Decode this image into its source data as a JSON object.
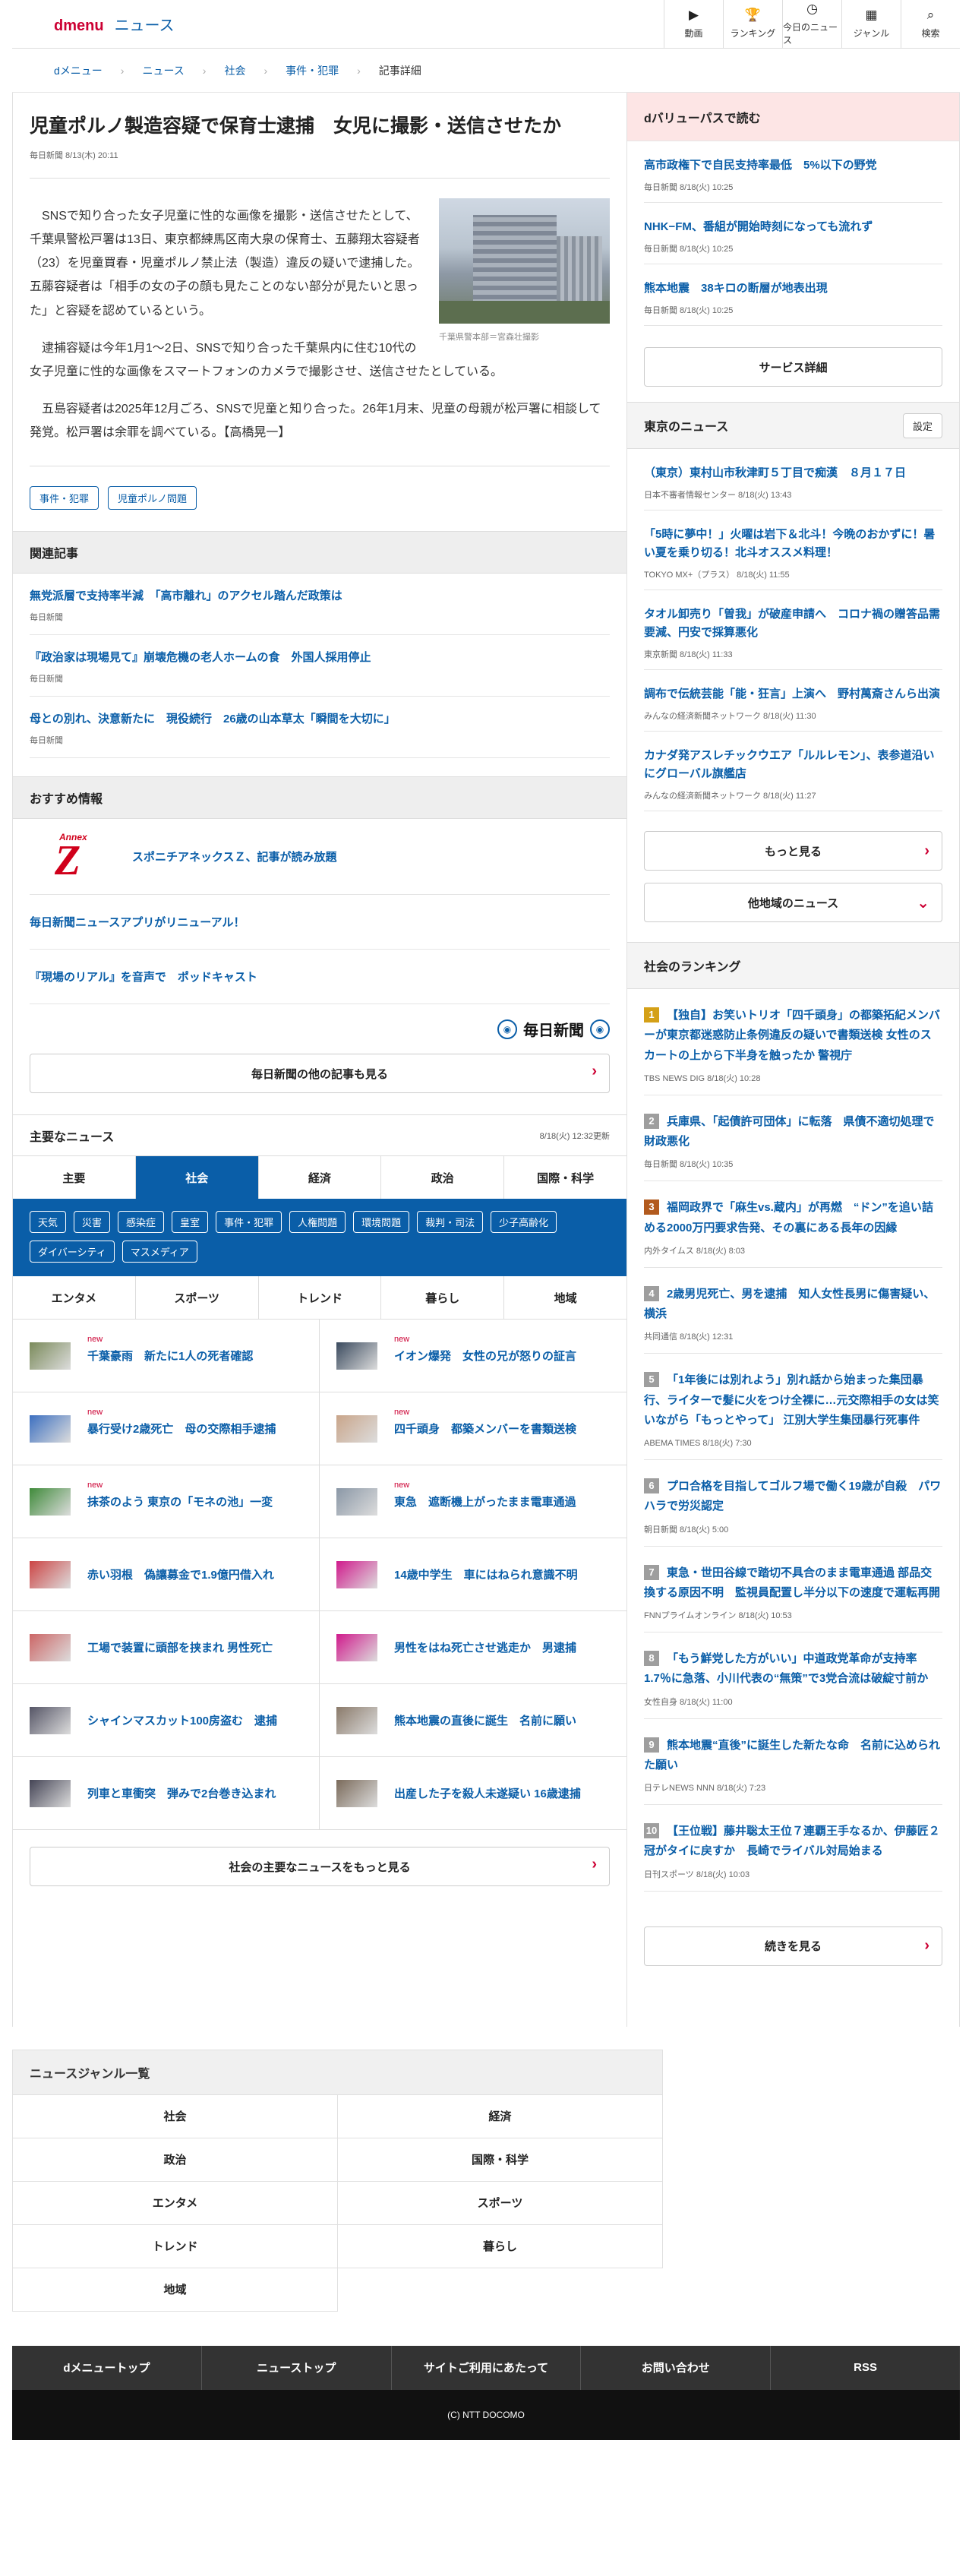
{
  "header": {
    "logo_d": "dmenu",
    "logo_news": "ニュース",
    "nav": [
      {
        "icon": "video-icon",
        "glyph": "▶",
        "label": "動画"
      },
      {
        "icon": "trophy-icon",
        "glyph": "🏆",
        "label": "ランキング"
      },
      {
        "icon": "clock-icon",
        "glyph": "◷",
        "label": "今日のニュース"
      },
      {
        "icon": "grid-icon",
        "glyph": "▦",
        "label": "ジャンル"
      },
      {
        "icon": "search-icon",
        "glyph": "⌕",
        "label": "検索"
      }
    ]
  },
  "breadcrumb": [
    "dメニュー",
    "ニュース",
    "社会",
    "事件・犯罪",
    "記事詳細"
  ],
  "article": {
    "title": "児童ポルノ製造容疑で保育士逮捕　女児に撮影・送信させたか",
    "meta": "毎日新聞 8/13(木) 20:11",
    "photo_caption": "千葉県警本部＝宮森壮撮影",
    "paragraphs": [
      "SNSで知り合った女子児童に性的な画像を撮影・送信させたとして、千葉県警松戸署は13日、東京都練馬区南大泉の保育士、五藤翔太容疑者（23）を児童買春・児童ポルノ禁止法（製造）違反の疑いで逮捕した。五藤容疑者は「相手の女の子の顔も見たことのない部分が見たいと思った」と容疑を認めているという。",
      "逮捕容疑は今年1月1〜2日、SNSで知り合った千葉県内に住む10代の女子児童に性的な画像をスマートフォンのカメラで撮影させ、送信させたとしている。",
      "五島容疑者は2025年12月ごろ、SNSで児童と知り合った。26年1月末、児童の母親が松戸署に相談して発覚。松戸署は余罪を調べている。【高橋晃一】"
    ],
    "tags": [
      "事件・犯罪",
      "児童ポルノ問題"
    ]
  },
  "related": {
    "heading": "関連記事",
    "items": [
      {
        "title": "無党派層で支持率半減　「高市離れ」のアクセル踏んだ政策は",
        "source": "毎日新聞"
      },
      {
        "title": "『政治家は現場見て』崩壊危機の老人ホームの食　外国人採用停止",
        "source": "毎日新聞"
      },
      {
        "title": "母との別れ、決意新たに　現役続行　26歳の山本草太「瞬間を大切に」",
        "source": "毎日新聞"
      }
    ]
  },
  "recommend": {
    "heading": "おすすめ情報",
    "annex_small": "Annex",
    "annex_big": "Z",
    "items": [
      "スポニチアネックスＺ、記事が読み放題",
      "毎日新聞ニュースアプリがリニューアル！",
      "『現場のリアル』を音声で　ポッドキャスト"
    ],
    "publisher": "毎日新聞",
    "more": "毎日新聞の他の記事も見る"
  },
  "main_news": {
    "heading": "主要なニュース",
    "updated": "8/18(火) 12:32更新",
    "tabs": [
      "主要",
      "社会",
      "経済",
      "政治",
      "国際・科学"
    ],
    "active_tab": "社会",
    "topic_tags": [
      "天気",
      "災害",
      "感染症",
      "皇室",
      "事件・犯罪",
      "人権問題",
      "環境問題",
      "裁判・司法",
      "少子高齢化",
      "ダイバーシティ",
      "マスメディア"
    ],
    "sub_tabs": [
      "エンタメ",
      "スポーツ",
      "トレンド",
      "暮らし",
      "地域"
    ],
    "new_label": "new",
    "items": [
      {
        "title": "千葉豪雨　新たに1人の死者確認",
        "new": true,
        "thumb": "#7a8a5a"
      },
      {
        "title": "イオン爆発　女性の兄が怒りの証言",
        "new": true,
        "thumb": "#3a4a5e"
      },
      {
        "title": "暴行受け2歳死亡　母の交際相手逮捕",
        "new": true,
        "thumb": "#3c6fc0"
      },
      {
        "title": "四千頭身　都築メンバーを書類送検",
        "new": true,
        "thumb": "#c9a58a"
      },
      {
        "title": "抹茶のよう 東京の「モネの池」一変",
        "new": true,
        "thumb": "#3f8a3a"
      },
      {
        "title": "東急　遮断機上がったまま電車通過",
        "new": true,
        "thumb": "#8a97a6"
      },
      {
        "title": "赤い羽根　偽讓募金で1.9億円借入れ",
        "new": false,
        "thumb": "#c44"
      },
      {
        "title": "14歳中学生　車にはねられ意識不明",
        "new": false,
        "thumb": "#d01a8c"
      },
      {
        "title": "工場で装置に頭部を挟まれ 男性死亡",
        "new": false,
        "thumb": "#c66"
      },
      {
        "title": "男性をはね死亡させ逃走か　男逮捕",
        "new": false,
        "thumb": "#d01a8c"
      },
      {
        "title": "シャインマスカット100房盗む　逮捕",
        "new": false,
        "thumb": "#556"
      },
      {
        "title": "熊本地震の直後に誕生　名前に願い",
        "new": false,
        "thumb": "#8a7a6a"
      },
      {
        "title": "列車と車衝突　弾みで2台巻き込まれ",
        "new": false,
        "thumb": "#445"
      },
      {
        "title": "出産した子を殺人未遂疑い 16歳逮捕",
        "new": false,
        "thumb": "#7a6a5a"
      }
    ],
    "more": "社会の主要なニュースをもっと見る"
  },
  "side": {
    "dvalue_heading": "dバリューパスで読む",
    "dvalue_items": [
      {
        "title": "高市政権下で自民支持率最低　5%以下の野党",
        "source": "毎日新聞 8/18(火) 10:25"
      },
      {
        "title": "NHK−FM、番組が開始時刻になっても流れず",
        "source": "毎日新聞 8/18(火) 10:25"
      },
      {
        "title": "熊本地震　38キロの断層が地表出現",
        "source": "毎日新聞 8/18(火) 10:25"
      }
    ],
    "service_btn": "サービス詳細",
    "tokyo_heading": "東京のニュース",
    "settings_label": "設定",
    "tokyo_items": [
      {
        "title": "（東京）東村山市秋津町５丁目で痴漢　８月１７日",
        "source": "日本不審者情報センター 8/18(火) 13:43"
      },
      {
        "title": "「5時に夢中！」火曜は岩下＆北斗！今晩のおかずに！暑い夏を乗り切る！北斗オススメ料理！",
        "source": "TOKYO MX+（プラス） 8/18(火) 11:55"
      },
      {
        "title": "タオル卸売り「曽我」が破産申請へ　コロナ禍の贈答品需要減、円安で採算悪化",
        "source": "東京新聞 8/18(火) 11:33"
      },
      {
        "title": "調布で伝統芸能「能・狂言」上演へ　野村萬斎さんら出演",
        "source": "みんなの経済新聞ネットワーク 8/18(火) 11:30"
      },
      {
        "title": "カナダ発アスレチックウエア「ルルレモン」、表参道沿いにグローバル旗艦店",
        "source": "みんなの経済新聞ネットワーク 8/18(火) 11:27"
      }
    ],
    "more_btn": "もっと見る",
    "other_region_btn": "他地域のニュース",
    "ranking_heading": "社会のランキング",
    "ranking": [
      {
        "no": "1",
        "title": "【独自】お笑いトリオ「四千頭身」の都築拓紀メンバーが東京都迷惑防止条例違反の疑いで書類送検 女性のスカートの上から下半身を触ったか 警視庁",
        "source": "TBS NEWS DIG 8/18(火) 10:28"
      },
      {
        "no": "2",
        "title": "兵庫県、「起債許可団体」に転落　県債不適切処理で財政悪化",
        "source": "毎日新聞 8/18(火) 10:35"
      },
      {
        "no": "3",
        "title": "福岡政界で「麻生vs.蔵内」が再燃　“ドン”を追い詰める2000万円要求告発、その裏にある長年の因縁",
        "source": "内外タイムス 8/18(火) 8:03"
      },
      {
        "no": "4",
        "title": "2歳男児死亡、男を逮捕　知人女性長男に傷害疑い、横浜",
        "source": "共同通信 8/18(火) 12:31"
      },
      {
        "no": "5",
        "title": "「1年後には別れよう」別れ話から始まった集団暴行、ライターで髪に火をつけ全裸に…元交際相手の女は笑いながら「もっとやって」 江別大学生集団暴行死事件",
        "source": "ABEMA TIMES 8/18(火) 7:30"
      },
      {
        "no": "6",
        "title": "プロ合格を目指してゴルフ場で働く19歳が自殺　パワハラで労災認定",
        "source": "朝日新聞 8/18(火) 5:00"
      },
      {
        "no": "7",
        "title": "東急・世田谷線で踏切不具合のまま電車通過 部品交換する原因不明　監視員配置し半分以下の速度で運転再開",
        "source": "FNNプライムオンライン 8/18(火) 10:53"
      },
      {
        "no": "8",
        "title": "「もう鮮党した方がいい」中道政党革命が支持率1.7％に急落、小川代表の“無策”で3党合流は破綻寸前か",
        "source": "女性自身 8/18(火) 11:00"
      },
      {
        "no": "9",
        "title": "熊本地震“直後”に誕生した新たな命　名前に込められた願い",
        "source": "日テレNEWS NNN 8/18(火) 7:23"
      },
      {
        "no": "10",
        "title": "【王位戦】藤井聡太王位７連覇王手なるか、伊藤匠２冠がタイに戻すか　長崎でライバル対局始まる",
        "source": "日刊スポーツ 8/18(火) 10:03"
      }
    ],
    "continue_btn": "続きを見る"
  },
  "genre": {
    "heading": "ニュースジャンル一覧",
    "items": [
      "社会",
      "経済",
      "政治",
      "国際・科学",
      "エンタメ",
      "スポーツ",
      "トレンド",
      "暮らし",
      "地域"
    ]
  },
  "footer": {
    "links": [
      "dメニュートップ",
      "ニューストップ",
      "サイトご利用にあたって",
      "お問い合わせ",
      "RSS"
    ],
    "copyright": "(C) NTT DOCOMO"
  }
}
